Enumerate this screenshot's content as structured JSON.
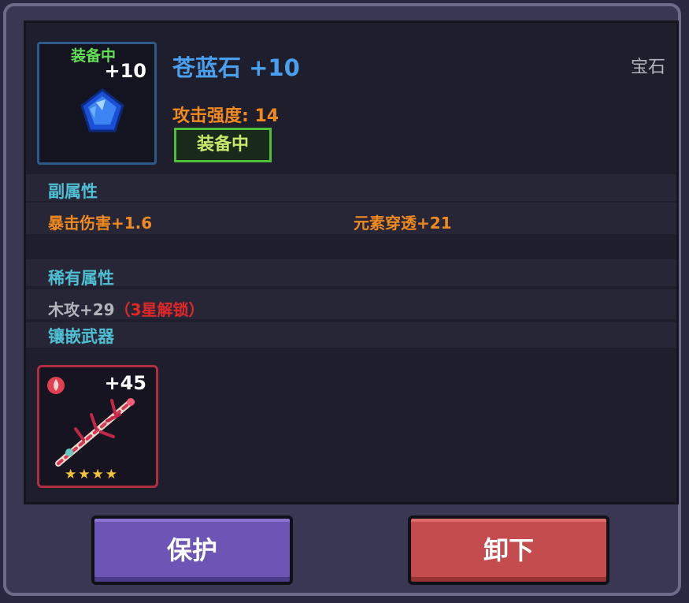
{
  "item": {
    "icon_tag": "装备中",
    "icon_level": "+10",
    "name": "苍蓝石 +10",
    "type": "宝石",
    "attack": "攻击强度: 14",
    "equipped_badge": "装备中"
  },
  "sub_attributes": {
    "title": "副属性",
    "stats": [
      "暴击伤害+1.6",
      "元素穿透+21"
    ]
  },
  "rare_attributes": {
    "title": "稀有属性",
    "value": "木攻+29",
    "lock_note": "（3星解锁）"
  },
  "inlaid_weapon": {
    "title": "镶嵌武器",
    "level": "+45",
    "stars": 4,
    "stars_text": "★★★★"
  },
  "buttons": {
    "protect": "保护",
    "unequip": "卸下"
  },
  "colors": {
    "name": "#4aa0f0",
    "attack": "#f08a1e",
    "section": "#4fc0d4",
    "equipped": "#4fbf3a",
    "protect_button": "#6c55b4",
    "unequip_button": "#c44c4e"
  }
}
